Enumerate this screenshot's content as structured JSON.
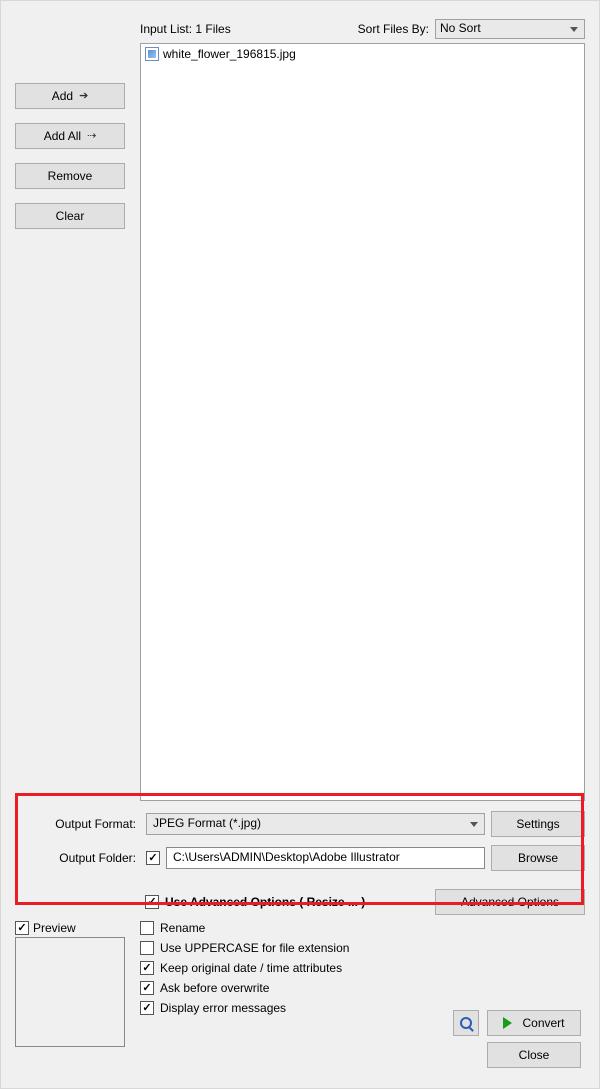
{
  "header": {
    "input_list_label": "Input List:  1 Files",
    "sort_label": "Sort Files By:",
    "sort_value": "No Sort"
  },
  "buttons": {
    "add": "Add",
    "add_all": "Add All",
    "remove": "Remove",
    "clear": "Clear",
    "settings": "Settings",
    "browse": "Browse",
    "advanced": "Advanced Options",
    "convert": "Convert",
    "close": "Close"
  },
  "files": [
    {
      "name": "white_flower_196815.jpg"
    }
  ],
  "output": {
    "format_label": "Output Format:",
    "format_value": "JPEG Format (*.jpg)",
    "folder_label": "Output Folder:",
    "folder_value": "C:\\Users\\ADMIN\\Desktop\\Adobe Illustrator"
  },
  "advanced_label": "Use Advanced Options ( Resize ... )",
  "preview_label": "Preview",
  "options": {
    "rename": "Rename",
    "uppercase": "Use UPPERCASE for file extension",
    "keep_date": "Keep original date / time attributes",
    "ask_overwrite": "Ask before overwrite",
    "display_errors": "Display error messages"
  }
}
